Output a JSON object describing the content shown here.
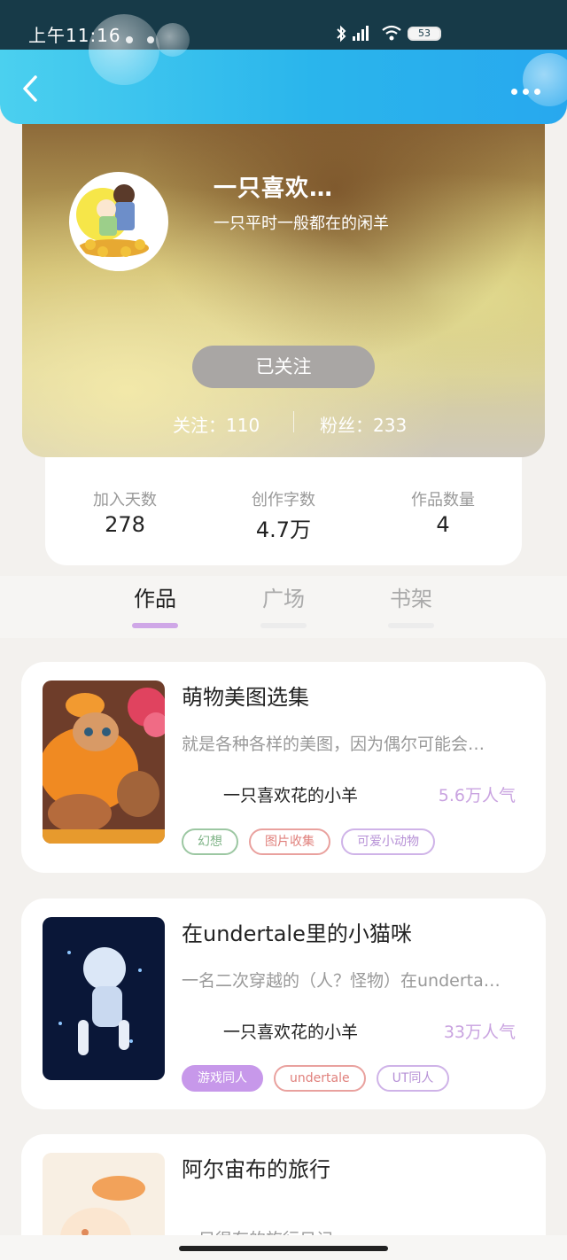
{
  "status_bar": {
    "time": "上午11:16",
    "battery": "53"
  },
  "profile": {
    "name": "一只喜欢…",
    "bio": "一只平时一般都在的闲羊",
    "follow_button": "已关注",
    "following": "关注：110",
    "fans": "粉丝：233"
  },
  "stats": [
    {
      "label": "加入天数",
      "value": "278"
    },
    {
      "label": "创作字数",
      "value": "4.7万"
    },
    {
      "label": "作品数量",
      "value": "4"
    }
  ],
  "tabs": [
    {
      "label": "作品",
      "active": true
    },
    {
      "label": "广场",
      "active": false
    },
    {
      "label": "书架",
      "active": false
    }
  ],
  "works": [
    {
      "title": "萌物美图选集",
      "desc": "就是各种各样的美图，因为偶尔可能会…",
      "author": "一只喜欢花的小羊",
      "popularity": "5.6万人气",
      "tags": [
        "幻想",
        "图片收集",
        "可爱小动物"
      ]
    },
    {
      "title": "在undertale里的小猫咪",
      "desc": "一名二次穿越的（人？怪物）在underta…",
      "author": "一只喜欢花的小羊",
      "popularity": "33万人气",
      "tags": [
        "游戏同人",
        "undertale",
        "UT同人"
      ]
    },
    {
      "title": "阿尔宙布的旅行",
      "desc": "一只很有的旅行日记",
      "author": "",
      "popularity": "",
      "tags": []
    }
  ],
  "colors": {
    "accent": "#cfa7e7",
    "topbar": "#2ab5ec",
    "popularity": "#c9a3e0"
  },
  "icons": [
    "back-icon",
    "more-icon",
    "bluetooth-icon",
    "signal-icon",
    "wifi-icon"
  ]
}
